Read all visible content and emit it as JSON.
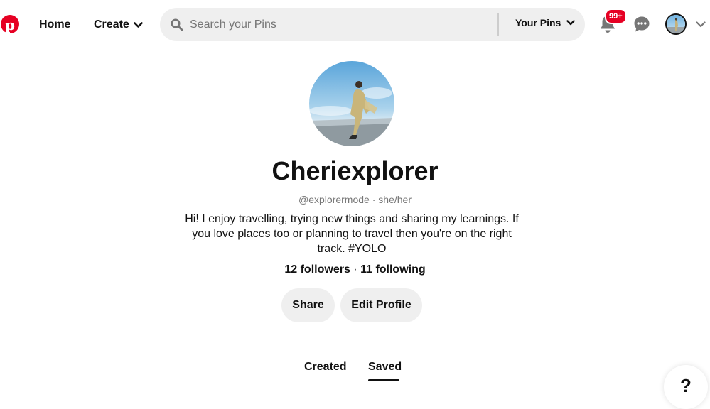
{
  "nav": {
    "logo_icon": "pinterest-logo-icon",
    "brand_color": "#e60023",
    "home_label": "Home",
    "create_label": "Create",
    "search": {
      "placeholder": "Search your Pins",
      "value": "",
      "scope_label": "Your Pins"
    },
    "notifications_badge": "99+",
    "icons": [
      "search-icon",
      "bell-icon",
      "chat-icon",
      "chevron-down-icon",
      "avatar"
    ]
  },
  "profile": {
    "display_name": "Cheriexplorer",
    "handle": "@explorermode",
    "separator": "·",
    "pronouns": "she/her",
    "bio": "Hi! I enjoy travelling, trying new things and sharing my learnings. If you love places too or planning to travel then you're on the right track. #YOLO",
    "followers": "12 followers",
    "following": "11 following",
    "stats_separator": "·"
  },
  "actions": {
    "share_label": "Share",
    "edit_label": "Edit Profile"
  },
  "tabs": {
    "created_label": "Created",
    "saved_label": "Saved",
    "active": "Saved"
  },
  "help": {
    "label": "?"
  },
  "colors": {
    "button_bg": "#efefef",
    "text": "#111111",
    "muted": "#767676"
  }
}
